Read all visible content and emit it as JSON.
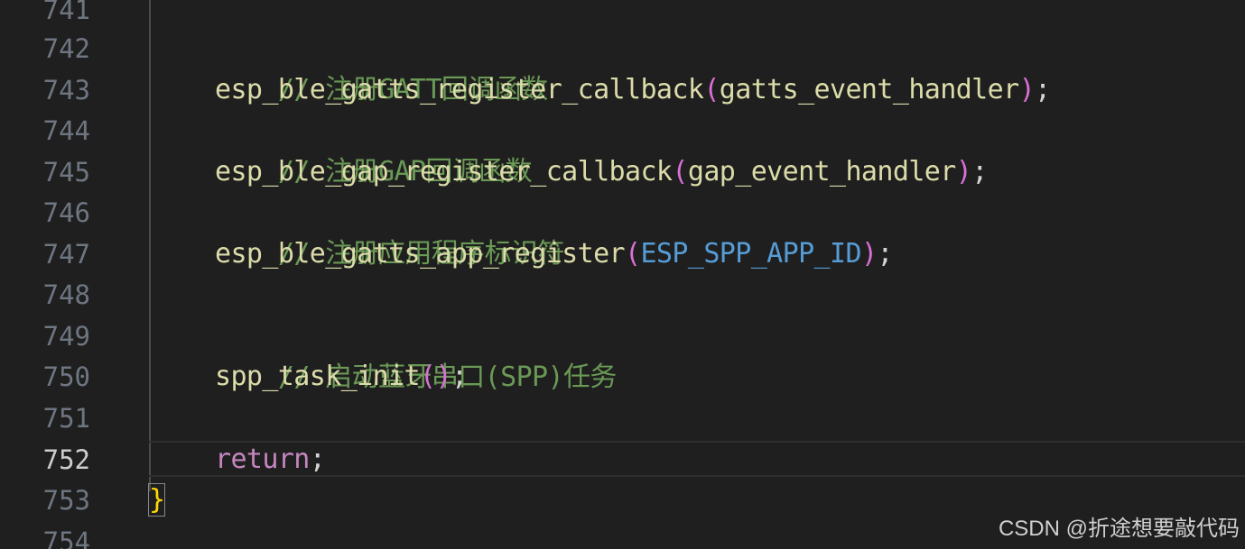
{
  "gutter": {
    "line_numbers": [
      "741",
      "742",
      "743",
      "744",
      "745",
      "746",
      "747",
      "748",
      "749",
      "750",
      "751",
      "752",
      "753",
      "754"
    ],
    "active_line": "752"
  },
  "code": {
    "l742_comment": "// 注册GATT回调函数",
    "l743_func": "esp_ble_gatts_register_callback",
    "l743_open": "(",
    "l743_arg": "gatts_event_handler",
    "l743_close": ")",
    "l743_semi": ";",
    "l744_comment": "// 注册GAP回调函数",
    "l745_func": "esp_ble_gap_register_callback",
    "l745_open": "(",
    "l745_arg": "gap_event_handler",
    "l745_close": ")",
    "l745_semi": ";",
    "l746_comment": "// 注册应用程序标识符",
    "l747_func": "esp_ble_gatts_app_register",
    "l747_open": "(",
    "l747_arg": "ESP_SPP_APP_ID",
    "l747_close": ")",
    "l747_semi": ";",
    "l749_comment": "// 启动蓝牙串口(SPP)任务",
    "l750_func": "spp_task_init",
    "l750_parens": "()",
    "l750_semi": ";",
    "l752_keyword": "return",
    "l752_semi": ";",
    "l753_brace": "}"
  },
  "watermark": "CSDN @折途想要敲代码",
  "colors": {
    "background": "#1f1f1f",
    "comment": "#6a9955",
    "function": "#dcdcaa",
    "macro": "#569cd6",
    "keyword": "#c586c0",
    "paren": "#da70d6",
    "brace": "#ffd700",
    "line_number": "#6e7681"
  }
}
